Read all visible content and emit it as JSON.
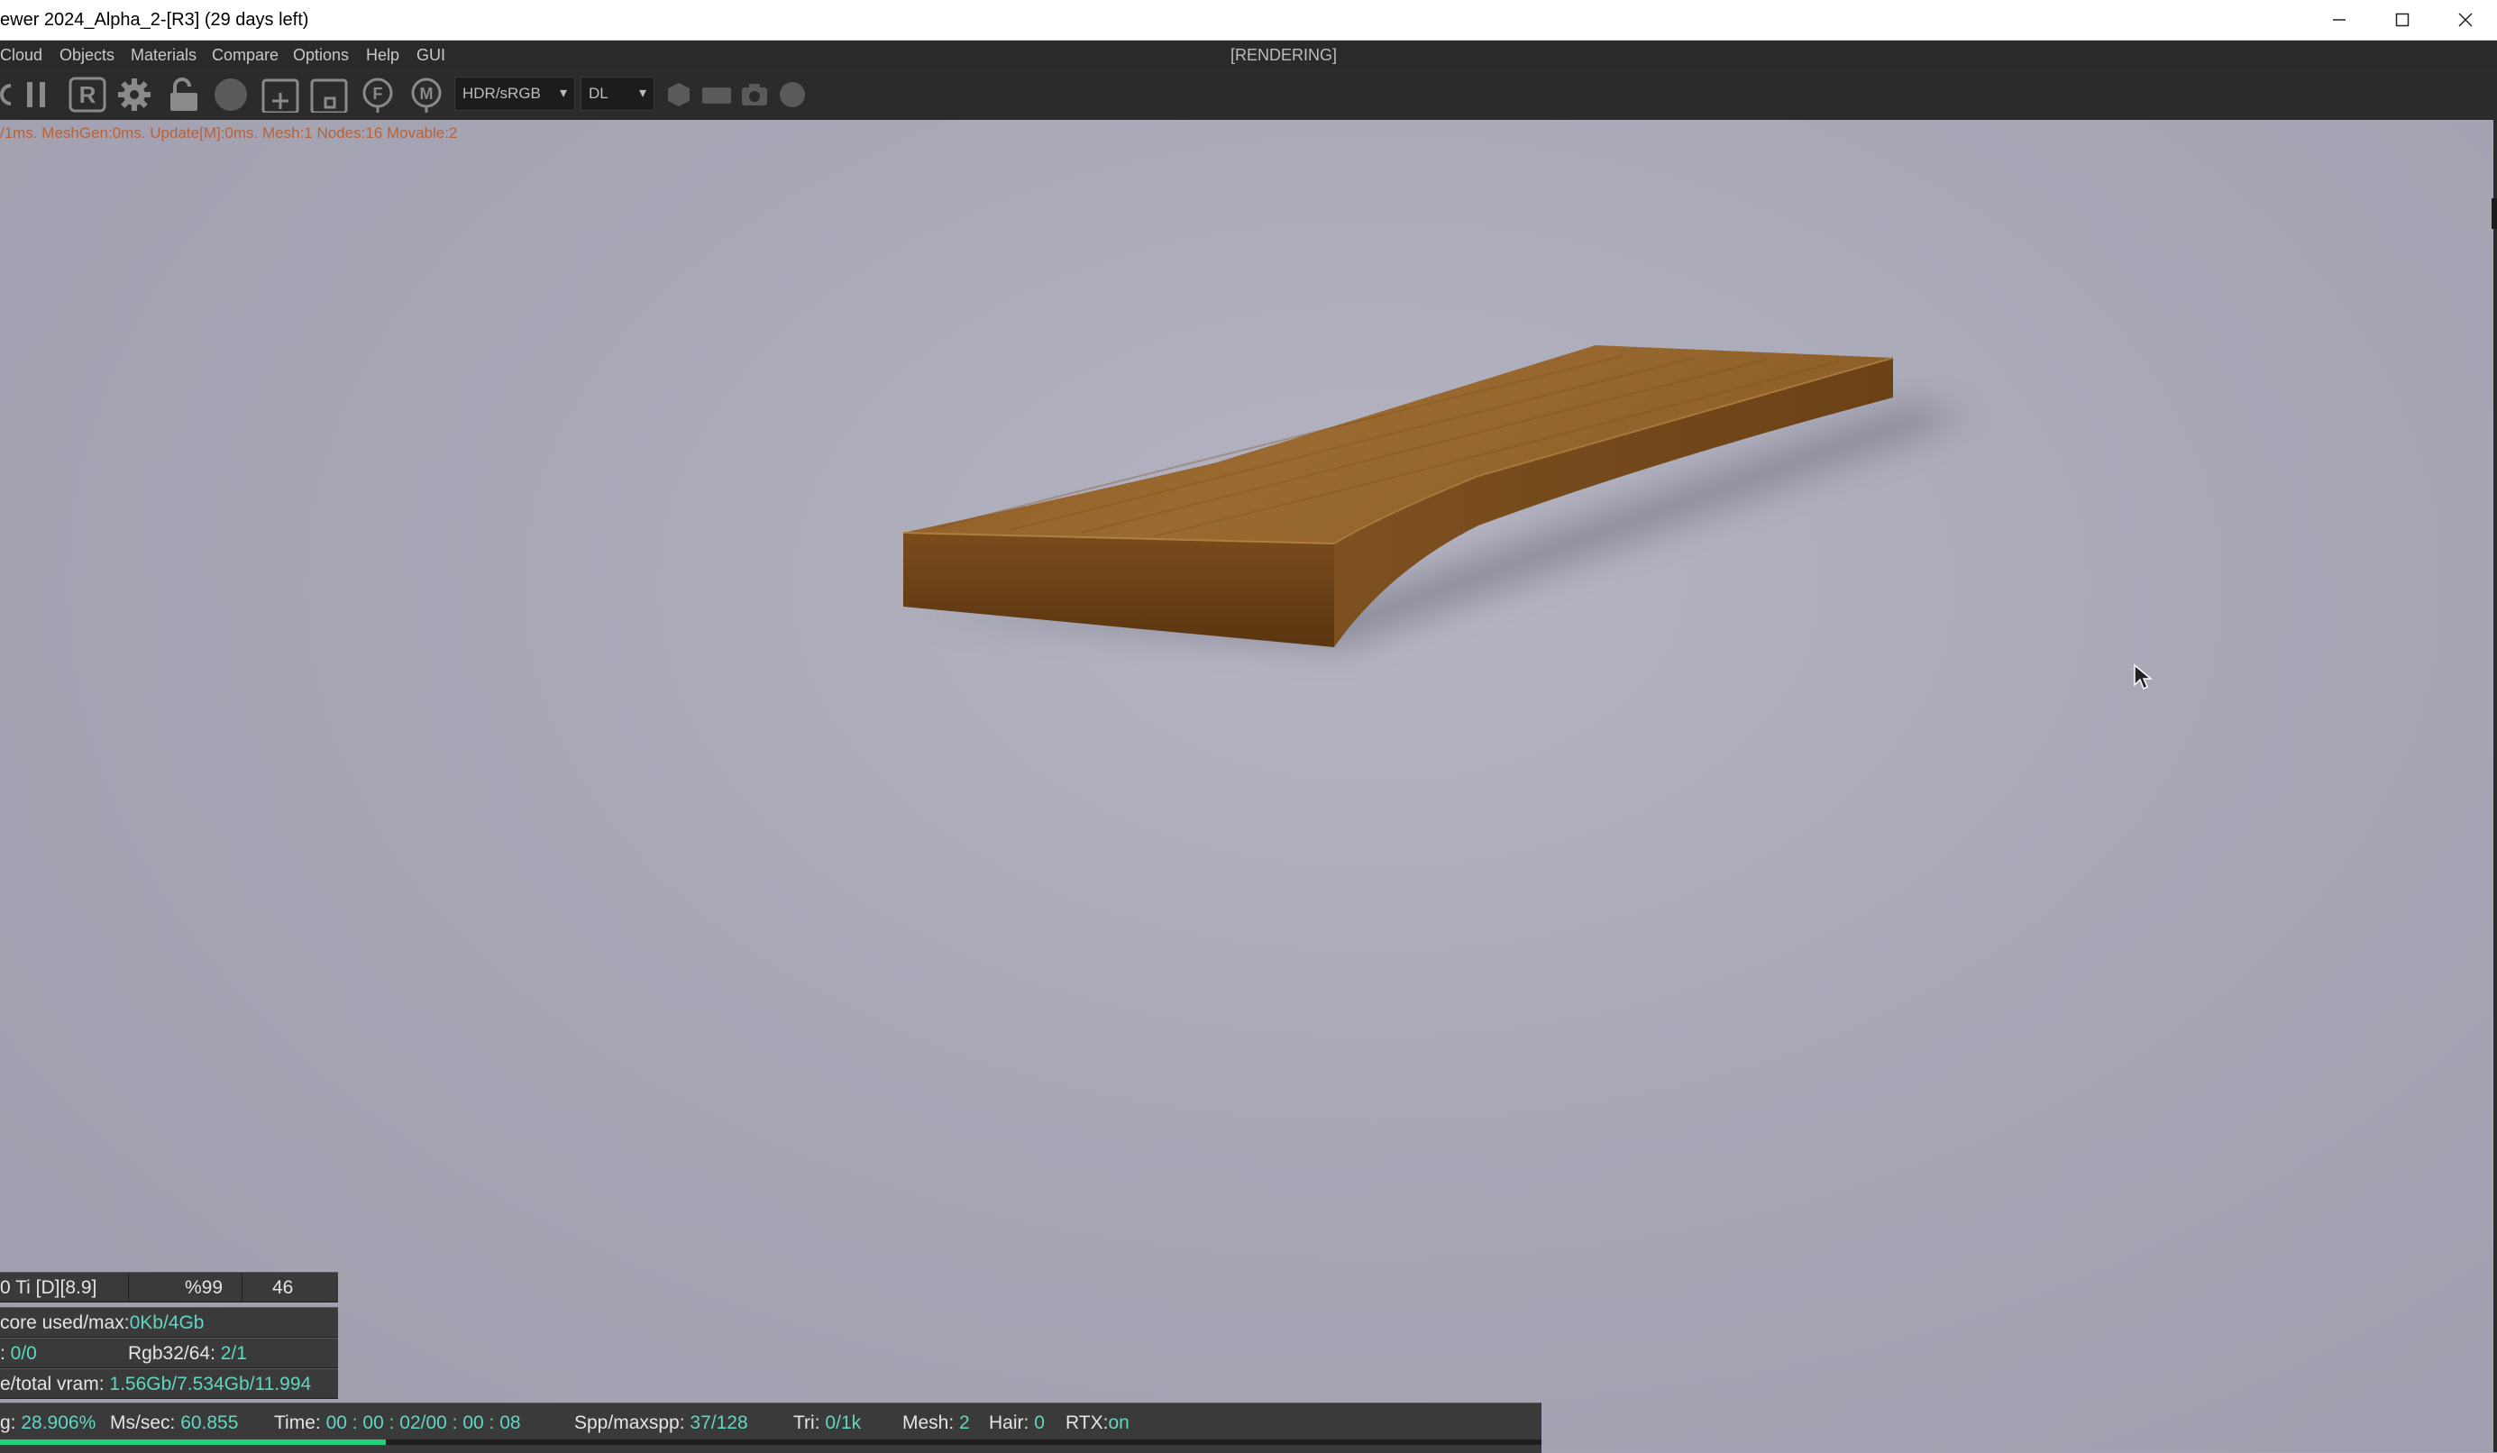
{
  "window": {
    "title": "ewer 2024_Alpha_2-[R3] (29 days left)",
    "minimize_glyph": "—",
    "maximize_glyph": "☐",
    "close_glyph": "✕"
  },
  "menu": {
    "items": [
      "Cloud",
      "Objects",
      "Materials",
      "Compare",
      "Options",
      "Help",
      "GUI"
    ],
    "status": "[RENDERING]"
  },
  "toolbar": {
    "icons": [
      "refresh-icon",
      "pause-icon",
      "render-r-icon",
      "settings-gear-icon",
      "unlock-icon",
      "sphere-icon",
      "add-box-icon",
      "box-icon",
      "f-circle-icon",
      "m-pin-icon"
    ],
    "r_label": "R",
    "f_label": "F",
    "m_label": "M",
    "color_mode": "HDR/sRGB",
    "kernel": "DL",
    "tail_icons": [
      "hexagon-icon",
      "rect-icon",
      "camera-icon",
      "circle-icon"
    ]
  },
  "stats_line": "/1ms. MeshGen:0ms. Update[M]:0ms. Mesh:1 Nodes:16 Movable:2",
  "info_panel": {
    "gpu": "0 Ti [D][8.9]",
    "gpu_util": "%99",
    "temp": "46",
    "core_label": "core used/max:",
    "core_value": "0Kb/4Gb",
    "row3_label": ": ",
    "row3_value": "0/0",
    "rgb_label": "Rgb32/64: ",
    "rgb_value": "2/1",
    "vram_label": "e/total vram: ",
    "vram_value": "1.56Gb/7.534Gb/11.994"
  },
  "status_bar": {
    "progress_label": "g: ",
    "progress_value": "28.906%",
    "ms_label": "Ms/sec: ",
    "ms_value": "60.855",
    "time_label": "Time: ",
    "time_value": "00 : 00 : 02/00 : 00 : 08",
    "spp_label": "Spp/maxspp: ",
    "spp_value": "37/128",
    "tri_label": "Tri: ",
    "tri_value": "0/1k",
    "mesh_label": "Mesh: ",
    "mesh_value": "2",
    "hair_label": "Hair: ",
    "hair_value": "0",
    "rtx_label": "RTX:",
    "rtx_value": "on",
    "progress_fraction": 0.25
  },
  "colors": {
    "accent_green": "#1fd17b",
    "value_cyan": "#5fd7c2",
    "stats_orange": "#b8623a",
    "wood": "#8a5a24"
  }
}
